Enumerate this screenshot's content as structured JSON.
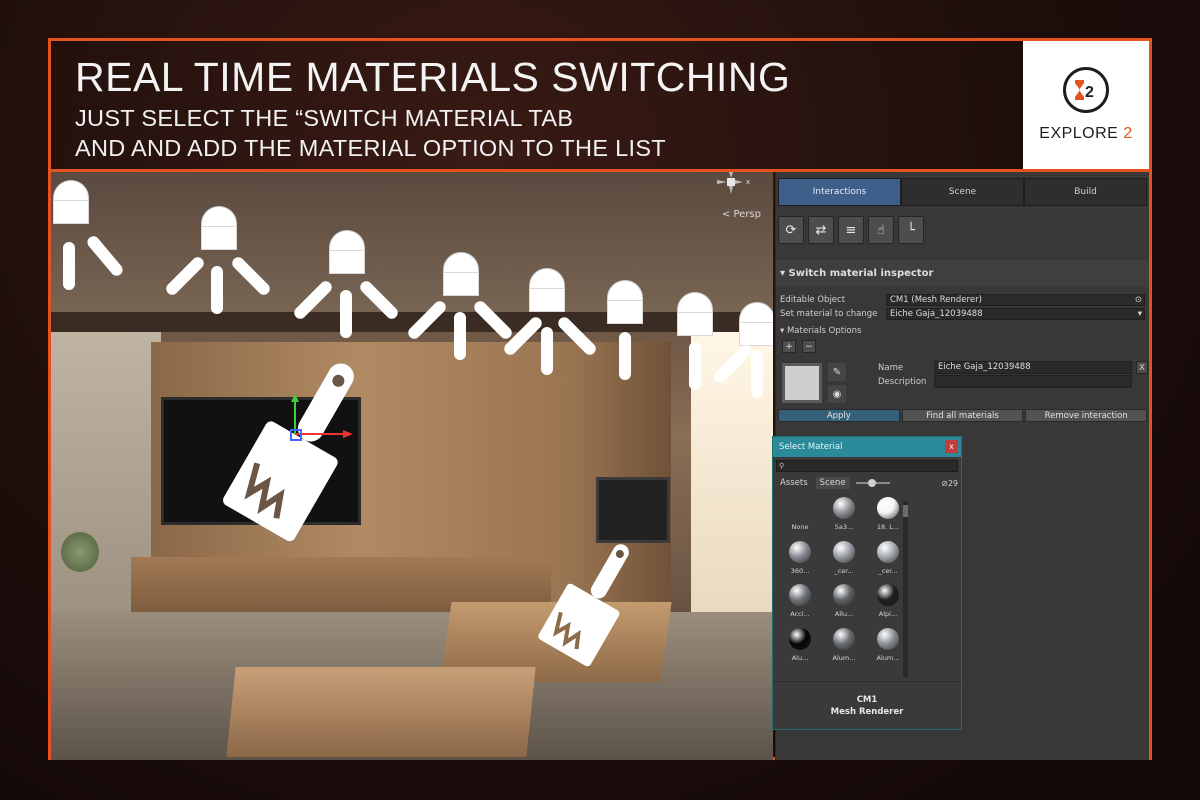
{
  "header": {
    "title": "REAL TIME MATERIALS SWITCHING",
    "subtitle_line1": "JUST SELECT THE “SWITCH MATERIAL TAB",
    "subtitle_line2": "AND AND ADD THE MATERIAL OPTION TO THE LIST"
  },
  "logo": {
    "text_prefix": "EXPLORE",
    "text_suffix": "2",
    "mark": "X2"
  },
  "viewport": {
    "persp_label": "< Persp",
    "gizmo_axis": "x"
  },
  "inspector": {
    "tabs": [
      {
        "label": "Interactions",
        "active": true
      },
      {
        "label": "Scene",
        "active": false
      },
      {
        "label": "Build",
        "active": false
      }
    ],
    "tools": [
      {
        "icon": "cycle-icon",
        "glyph": "⟳"
      },
      {
        "icon": "swap-arrows-icon",
        "glyph": "⇄"
      },
      {
        "icon": "paint-roller-icon",
        "glyph": "≡"
      },
      {
        "icon": "hand-touch-icon",
        "glyph": "☝"
      },
      {
        "icon": "hierarchy-icon",
        "glyph": "└"
      }
    ],
    "section_title": "Switch material inspector",
    "editable_object_label": "Editable Object",
    "editable_object_value": "CM1 (Mesh Renderer)",
    "set_material_label": "Set material to change",
    "set_material_value": "Eiche Gaja_12039488",
    "materials_options_label": "Materials Options",
    "plus": "+",
    "minus": "−",
    "entry": {
      "name_label": "Name",
      "name_value": "Eiche Gaja_12039488",
      "description_label": "Description",
      "remove_glyph": "X"
    },
    "actions": {
      "apply": "Apply",
      "find_all": "Find all materials",
      "remove": "Remove interaction"
    }
  },
  "select_material": {
    "title": "Select Material",
    "close_glyph": "x",
    "tab_assets": "Assets",
    "tab_scene": "Scene",
    "count": "29",
    "items": [
      {
        "label": "None",
        "color": "none"
      },
      {
        "label": "5a3...",
        "color": "#8c8f94"
      },
      {
        "label": "18. L...",
        "color": "#f4f4f4"
      },
      {
        "label": "360...",
        "color": "#8a8e94"
      },
      {
        "label": "_cer...",
        "color": "#9a9ea4"
      },
      {
        "label": "_cer...",
        "color": "#a6aaaf"
      },
      {
        "label": "Acci...",
        "color": "#707479"
      },
      {
        "label": "Allu...",
        "color": "#5f6368"
      },
      {
        "label": "Alpi...",
        "color": "#1e1e1e"
      },
      {
        "label": "Alu...",
        "color": "#050505"
      },
      {
        "label": "Alum...",
        "color": "#6a6e73"
      },
      {
        "label": "Alum...",
        "color": "#8d9196"
      }
    ],
    "footer_line1": "CM1",
    "footer_line2": "Mesh Renderer"
  }
}
